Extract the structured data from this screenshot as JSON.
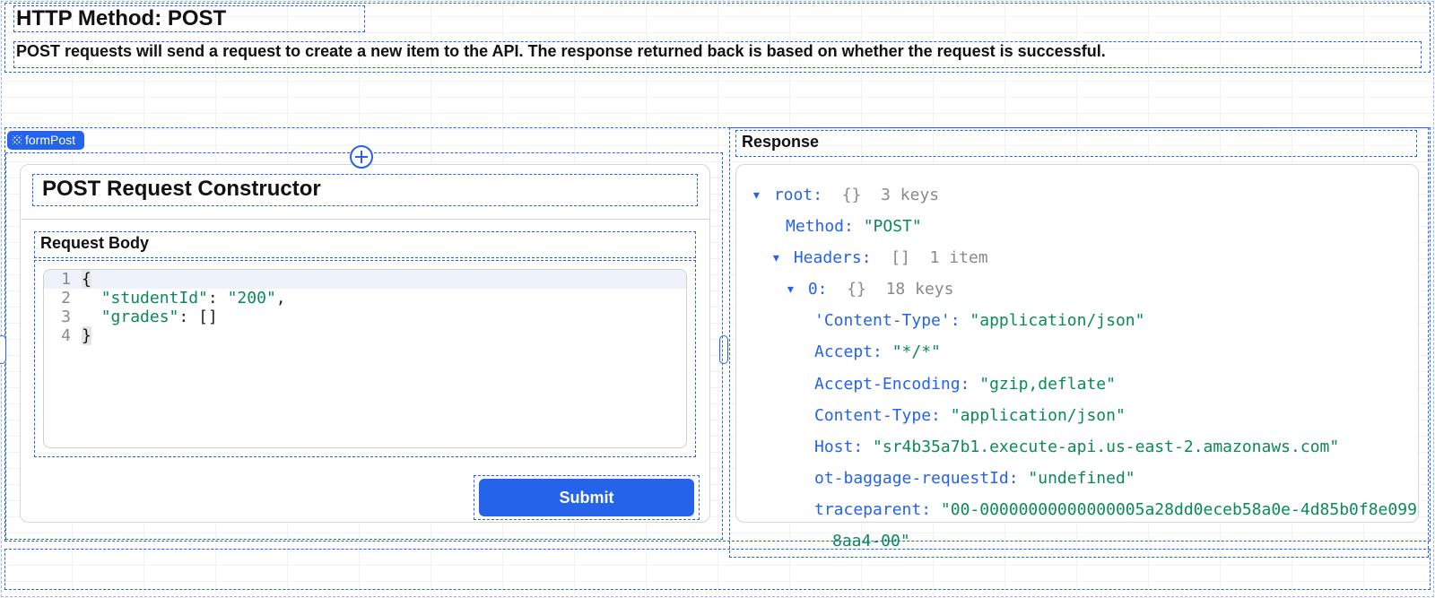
{
  "header": {
    "title": "HTTP Method: POST",
    "description": "POST requests will send a request to create a new item to the API. The response returned back is based on whether the request is successful."
  },
  "tag": {
    "label": "formPost"
  },
  "constructor": {
    "title": "POST Request Constructor",
    "body_label": "Request Body",
    "submit_label": "Submit",
    "code_lines": [
      {
        "n": "1",
        "text": "{"
      },
      {
        "n": "2",
        "text": "  \"studentId\": \"200\","
      },
      {
        "n": "3",
        "text": "  \"grades\": []"
      },
      {
        "n": "4",
        "text": "}"
      }
    ]
  },
  "response": {
    "label": "Response",
    "tree": {
      "root_key": "root:",
      "root_meta_brace": "{}",
      "root_meta_count": "3 keys",
      "method_key": "Method:",
      "method_val": "\"POST\"",
      "headers_key": "Headers:",
      "headers_meta_brace": "[]",
      "headers_meta_count": "1 item",
      "idx0_key": "0:",
      "idx0_meta_brace": "{}",
      "idx0_meta_count": "18 keys",
      "ct1_key": "'Content-Type':",
      "ct1_val": "\"application/json\"",
      "accept_key": "Accept:",
      "accept_val": "\"*/*\"",
      "ae_key": "Accept-Encoding:",
      "ae_val": "\"gzip,deflate\"",
      "ct2_key": "Content-Type:",
      "ct2_val": "\"application/json\"",
      "host_key": "Host:",
      "host_val": "\"sr4b35a7b1.execute-api.us-east-2.amazonaws.com\"",
      "ot_key": "ot-baggage-requestId:",
      "ot_val": "\"undefined\"",
      "tp_key": "traceparent:",
      "tp_val_a": "\"00-00000000000000005a28dd0eceb58a0e-4d85b0f8e099",
      "tp_val_b": "8aa4-00\""
    }
  }
}
